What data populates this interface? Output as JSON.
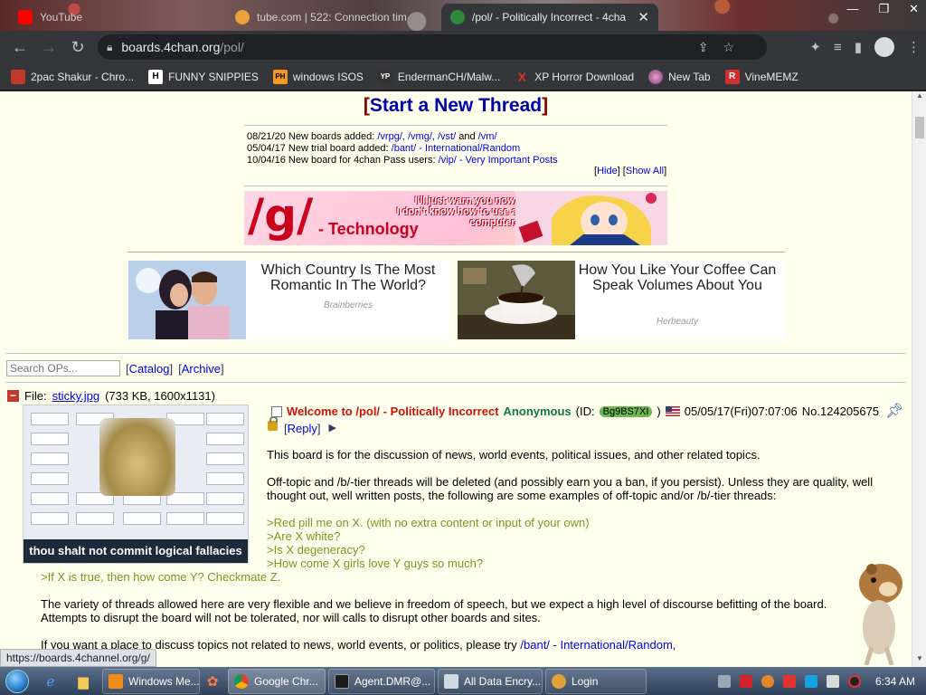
{
  "browser": {
    "tabs": [
      {
        "title": "YouTube",
        "active": false
      },
      {
        "title": "tube.com | 522: Connection tim",
        "active": false
      },
      {
        "title": "/pol/ - Politically Incorrect - 4cha",
        "active": true
      }
    ],
    "url_host": "boards.4chan.org",
    "url_path": "/pol/",
    "bookmarks": [
      {
        "label": "2pac Shakur - Chro...",
        "icon": "puzzle-icon",
        "icon_text": ""
      },
      {
        "label": "FUNNY SNIPPIES",
        "icon": "h-icon",
        "icon_text": "H"
      },
      {
        "label": "windows ISOS",
        "icon": "ph-icon",
        "icon_text": "PH"
      },
      {
        "label": "EndermanCH/Malw...",
        "icon": "yp-icon",
        "icon_text": "YP"
      },
      {
        "label": "XP Horror Download",
        "icon": "x-icon",
        "icon_text": "X"
      },
      {
        "label": "New Tab",
        "icon": "globe-icon",
        "icon_text": ""
      },
      {
        "label": "VineMEMZ",
        "icon": "r-icon",
        "icon_text": "R"
      }
    ],
    "status_url": "https://boards.4channel.org/g/"
  },
  "page": {
    "start_thread_open": "[",
    "start_thread": "Start a New Thread",
    "start_thread_close": "]",
    "news": [
      {
        "date": "08/21/20",
        "text": "New boards added:",
        "links": "/vrpg/, /vmg/, /vst/",
        "tail": "and",
        "link2": "/vm/"
      },
      {
        "date": "05/04/17",
        "text": "New trial board added:",
        "links": "/bant/ - International/Random",
        "tail": "",
        "link2": ""
      },
      {
        "date": "10/04/16",
        "text": "New board for 4chan Pass users:",
        "links": "/vip/ - Very Important Posts",
        "tail": "",
        "link2": ""
      }
    ],
    "news_hide": "Hide",
    "news_show_all": "Show All",
    "banner": {
      "board": "/g/",
      "board_name": "- Technology",
      "line1": "I'll just warn you now.",
      "line2": "I don't know how to use a computer."
    },
    "ads": [
      {
        "headline": "Which Country Is The Most Romantic In The World?",
        "source": "Brainberries"
      },
      {
        "headline": "How You Like Your Coffee Can Speak Volumes About You",
        "source": "Herbeauty"
      }
    ],
    "search_placeholder": "Search OPs...",
    "catalog": "Catalog",
    "archive": "Archive"
  },
  "post": {
    "file_label": "File:",
    "file_name": "sticky.jpg",
    "file_meta": "(733 KB, 1600x1131)",
    "thumb_caption": "thou shalt not commit logical fallacies",
    "subject": "Welcome to /pol/ - Politically Incorrect",
    "name": "Anonymous",
    "id_prefix": "(ID:",
    "id": "Bg9BS7XI",
    "id_suffix": ")",
    "datetime": "05/05/17(Fri)07:07:06",
    "number": "No.124205675",
    "reply": "Reply",
    "reply_arrow": "▶",
    "body_intro": "This board is for the discussion of news, world events, political issues, and other related topics.",
    "body_offtopic": "Off-topic and /b/-tier threads will be deleted (and possibly earn you a ban, if you persist). Unless they are quality, well thought out, well written posts, the following are some examples of off-topic and/or /b/-tier threads:",
    "quotes": [
      ">Red pill me on X. (with no extra content or input of your own)",
      ">Are X white?",
      ">Is X degeneracy?",
      ">How come X girls love Y guys so much?",
      ">If X is true, then how come Y? Checkmate Z."
    ],
    "body_variety": "The variety of threads allowed here are very flexible and we believe in freedom of speech, but we expect a high level of discourse befitting of the board. Attempts to disrupt the board will not be tolerated, nor will calls to disrupt other boards and sites.",
    "body_bant_pre": "If you want a place to discuss topics not related to news, world events, or politics, please try",
    "body_bant_link": "/bant/ - International/Random,"
  },
  "taskbar": {
    "tasks": [
      {
        "label": "Windows Me...",
        "icon": "media-player-icon"
      },
      {
        "label": "Google Chr...",
        "icon": "chrome-icon"
      },
      {
        "label": "Agent.DMR@...",
        "icon": "terminal-icon"
      },
      {
        "label": "All Data Encry...",
        "icon": "window-icon"
      },
      {
        "label": "Login",
        "icon": "user-icon"
      }
    ],
    "clock": "6:34 AM"
  },
  "colors": {
    "page_bg": "#ffffee",
    "subject": "#cc1105",
    "name": "#117743",
    "greentext": "#789922",
    "link": "#0000ee"
  }
}
